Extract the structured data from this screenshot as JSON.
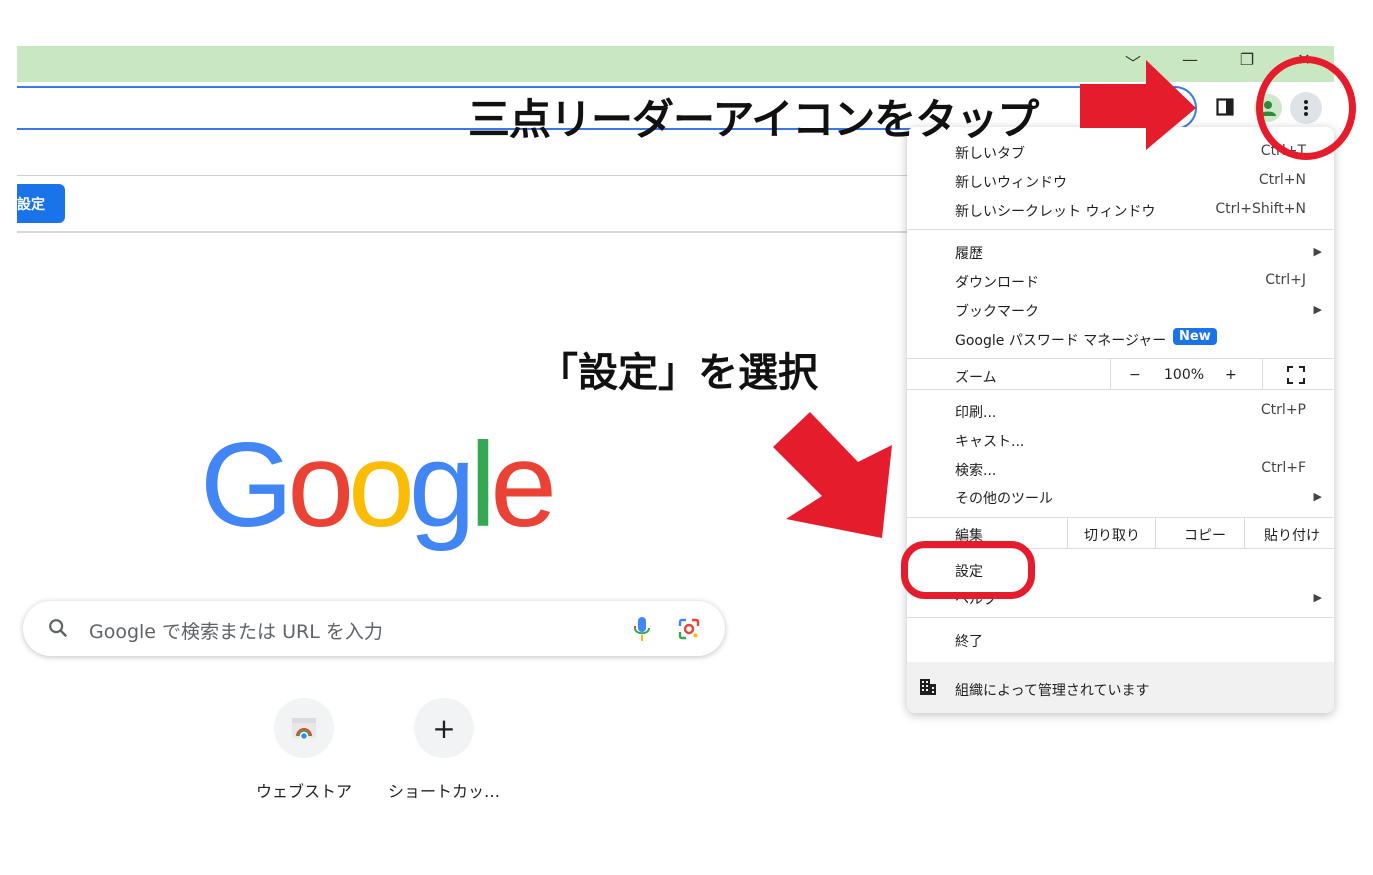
{
  "window": {
    "controls": [
      "﹀",
      "—",
      "❐",
      "✕"
    ]
  },
  "page": {
    "settings_button": "設定",
    "search_placeholder": "Google で検索または URL を入力",
    "shortcuts": [
      {
        "label": "ウェブストア",
        "icon": "webstore-icon"
      },
      {
        "label": "ショートカッ…",
        "icon": "add-icon",
        "glyph": "+"
      }
    ],
    "google_letters": [
      {
        "ch": "G",
        "color": "#4285f4"
      },
      {
        "ch": "o",
        "color": "#ea4335"
      },
      {
        "ch": "o",
        "color": "#fbbc05"
      },
      {
        "ch": "g",
        "color": "#4285f4"
      },
      {
        "ch": "l",
        "color": "#34a853"
      },
      {
        "ch": "e",
        "color": "#ea4335"
      }
    ]
  },
  "annotations": {
    "tap_kebab": "三点リーダーアイコンをタップ",
    "select_settings": "「設定」を選択"
  },
  "menu": {
    "new_tab": "新しいタブ",
    "new_tab_shortcut": "Ctrl+T",
    "new_window": "新しいウィンドウ",
    "new_window_shortcut": "Ctrl+N",
    "new_incognito": "新しいシークレット ウィンドウ",
    "new_incognito_shortcut": "Ctrl+Shift+N",
    "history": "履歴",
    "downloads": "ダウンロード",
    "downloads_shortcut": "Ctrl+J",
    "bookmarks": "ブックマーク",
    "password_manager": "Google パスワード マネージャー",
    "new_badge": "New",
    "zoom": "ズーム",
    "zoom_minus": "−",
    "zoom_level": "100%",
    "zoom_plus": "+",
    "print": "印刷...",
    "print_shortcut": "Ctrl+P",
    "cast": "キャスト...",
    "find": "検索...",
    "find_shortcut": "Ctrl+F",
    "more_tools": "その他のツール",
    "edit": "編集",
    "cut": "切り取り",
    "copy": "コピー",
    "paste": "貼り付け",
    "settings": "設定",
    "help": "ヘルプ",
    "exit": "終了",
    "managed": "組織によって管理されています"
  },
  "colors": {
    "titlebar": "#c9e8c2",
    "accent": "#1a73e8",
    "annotation_red": "#e51c2c"
  }
}
